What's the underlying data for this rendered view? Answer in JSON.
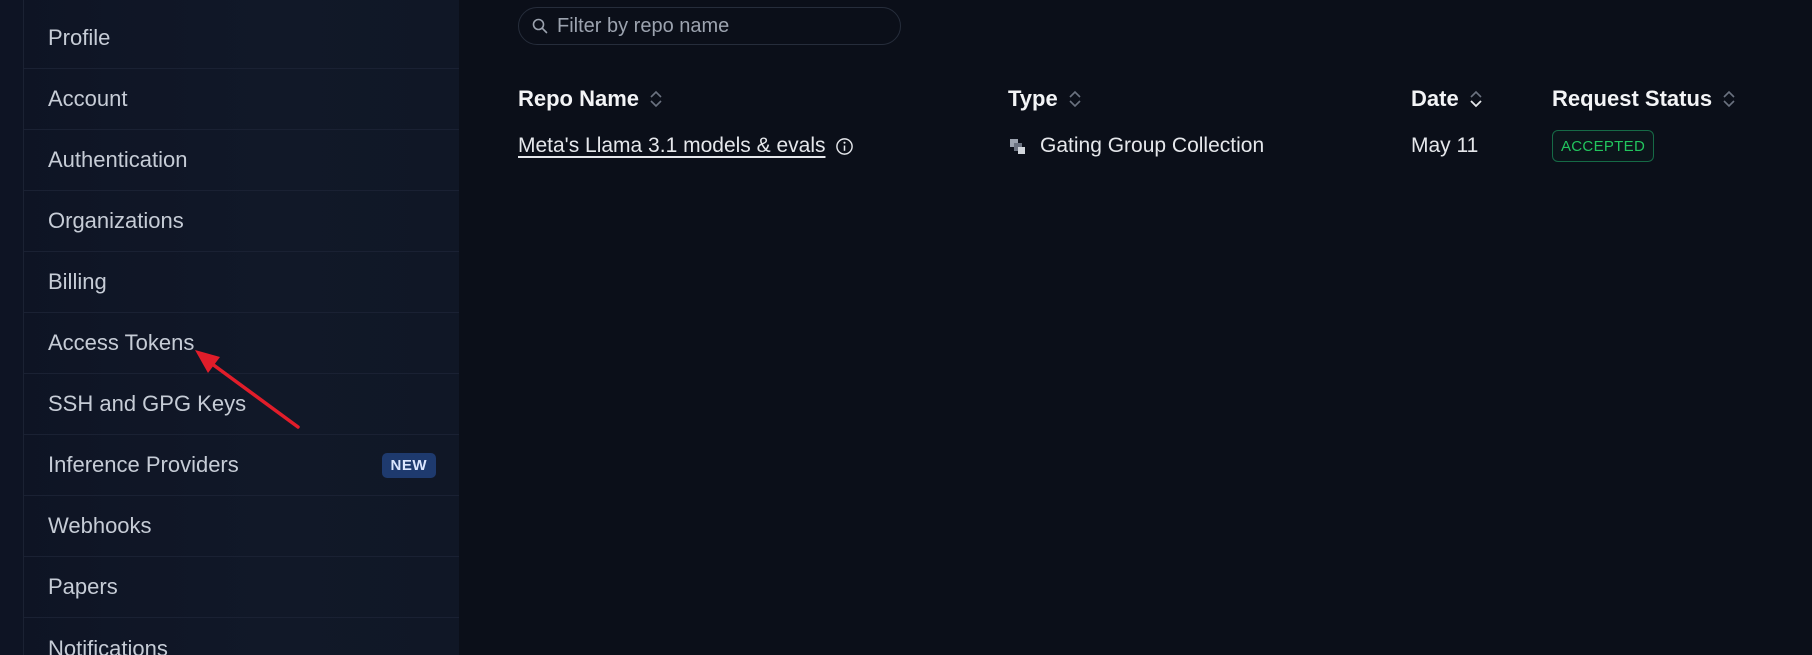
{
  "sidebar": {
    "items": [
      {
        "label": "Profile"
      },
      {
        "label": "Account"
      },
      {
        "label": "Authentication"
      },
      {
        "label": "Organizations"
      },
      {
        "label": "Billing"
      },
      {
        "label": "Access Tokens"
      },
      {
        "label": "SSH and GPG Keys"
      },
      {
        "label": "Inference Providers",
        "badge": "NEW"
      },
      {
        "label": "Webhooks"
      },
      {
        "label": "Papers"
      },
      {
        "label": "Notifications"
      }
    ]
  },
  "search": {
    "placeholder": "Filter by repo name"
  },
  "table": {
    "columns": [
      "Repo Name",
      "Type",
      "Date",
      "Request Status"
    ],
    "rows": [
      {
        "repo_name": "Meta's Llama 3.1 models & evals",
        "type": "Gating Group Collection",
        "date": "May 11",
        "status": "ACCEPTED"
      }
    ]
  },
  "colors": {
    "background": "#0b0f19",
    "sidebar": "#111828",
    "accepted": "#22c55e",
    "badge_new": "#1e3a6e",
    "annotation_arrow": "#e11d2a"
  },
  "icons": [
    "search-icon",
    "sort-icon",
    "info-icon",
    "collection-icon",
    "annotation-arrow"
  ]
}
